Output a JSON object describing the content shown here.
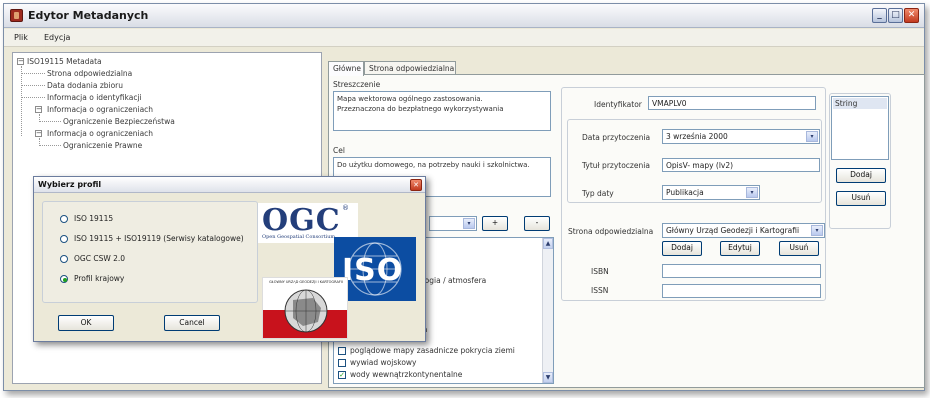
{
  "window": {
    "title": "Edytor Metadanych",
    "min": "_",
    "max": "□",
    "close": "✕"
  },
  "menu": {
    "items": [
      "Plik",
      "Edycja"
    ]
  },
  "tree": {
    "root": "ISO19115 Metadata",
    "items": [
      {
        "label": "Strona odpowiedzialna"
      },
      {
        "label": "Data dodania zbioru"
      },
      {
        "label": "Informacja o identyfikacji"
      },
      {
        "label": "Informacja o ograniczeniach"
      },
      {
        "label": "Ograniczenie Bezpieczeństwa"
      },
      {
        "label": "Informacja o ograniczeniach"
      },
      {
        "label": "Ograniczenie Prawne"
      }
    ],
    "expander": "−"
  },
  "tabs": [
    {
      "label": "Główne"
    },
    {
      "label": "Strona odpowiedzialna"
    }
  ],
  "main": {
    "streszczenie_label": "Streszczenie",
    "streszczenie_line1": "Mapa wektorowa ogólnego zastosowania.",
    "streszczenie_line2": "Przeznaczona do bezpłatnego wykorzystywania",
    "cel_label": "Cel",
    "cel_value": "Do użytku domowego, na potrzeby nauki i szkolnictwa.",
    "plus": "+",
    "minus": "-",
    "topics_partial": [
      "ologia / atmosfera",
      "na"
    ],
    "topics": [
      {
        "label": "poglądowe mapy zasadnicze pokrycia ziemi",
        "checked": false
      },
      {
        "label": "wywiad wojskowy",
        "checked": false
      },
      {
        "label": "wody wewnątrzkontynentalne",
        "checked": true
      }
    ],
    "check_mark": "✓",
    "identyfikator_label": "Identyfikator",
    "identyfikator_value": "VMAPLV0",
    "data_przytoczenia_label": "Data przytoczenia",
    "data_przytoczenia_value": "3   września   2000",
    "tytul_label": "Tytuł przytoczenia",
    "tytul_value": "OpisV- mapy (lv2)",
    "typ_daty_label": "Typ daty",
    "typ_daty_value": "Publikacja",
    "strona_label": "Strona odpowiedzialna",
    "strona_value": "Główny Urząd Geodezji i Kartografii",
    "dodaj": "Dodaj",
    "edytuj": "Edytuj",
    "usun": "Usuń",
    "isbn_label": "ISBN",
    "issn_label": "ISSN",
    "isbn_value": "",
    "issn_value": "",
    "string_item": "String",
    "dropdown_arrow": "▾",
    "scroll_up": "▲",
    "scroll_down": "▼"
  },
  "dialog": {
    "title": "Wybierz profil",
    "close": "✕",
    "options": [
      {
        "label": "ISO 19115",
        "selected": false
      },
      {
        "label": "ISO 19115 + ISO19119 (Serwisy katalogowe)",
        "selected": false
      },
      {
        "label": "OGC CSW 2.0",
        "selected": false
      },
      {
        "label": "Profil krajowy",
        "selected": true
      }
    ],
    "ok": "OK",
    "cancel": "Cancel",
    "ogc_logo": "OGC",
    "ogc_reg": "®",
    "ogc_sub": "Open Geospatial Consortium",
    "iso_logo": "ISO",
    "gugik_caption": "GŁÓWNY URZĄD GEODEZJI I KARTOGRAFII"
  }
}
